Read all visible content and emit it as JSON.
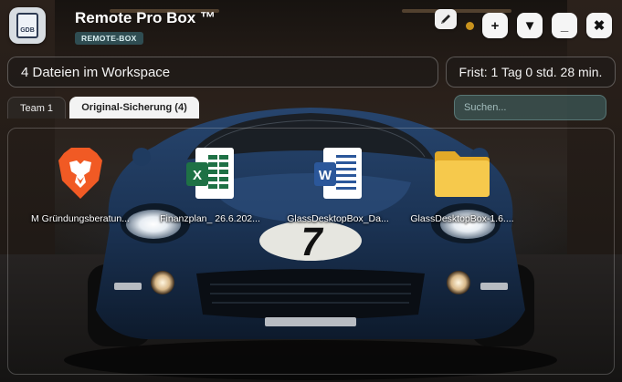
{
  "window": {
    "title": "Remote Pro Box ™",
    "badge": "REMOTE-BOX",
    "logo_text": "GDB"
  },
  "header_buttons": {
    "edit_icon": "pencil-icon",
    "status_dot_color": "#c8921d",
    "add_label": "+",
    "dropdown_label": "▼",
    "minimize_label": "_",
    "close_label": "✖"
  },
  "workspace": {
    "count_text": "4 Dateien im Workspace",
    "deadline_text": "Frist: 1 Tag 0 std. 28 min."
  },
  "tabs": [
    {
      "label": "Team 1",
      "active": false
    },
    {
      "label": "Original-Sicherung (4)",
      "active": true
    }
  ],
  "search": {
    "placeholder": "Suchen...",
    "value": ""
  },
  "files": [
    {
      "name": "M Gründungsberatun...",
      "icon": "brave-browser-icon"
    },
    {
      "name": "Finanzplan_ 26.6.202...",
      "icon": "excel-icon"
    },
    {
      "name": "GlassDesktopBox_Da...",
      "icon": "word-icon"
    },
    {
      "name": "GlassDesktopBox-1.6....",
      "icon": "folder-icon"
    }
  ],
  "colors": {
    "accent_teal": "#2f4d52",
    "excel_green": "#1e7145",
    "word_blue": "#2b579a",
    "brave_orange": "#f15a24",
    "folder_yellow": "#f6c94c"
  }
}
